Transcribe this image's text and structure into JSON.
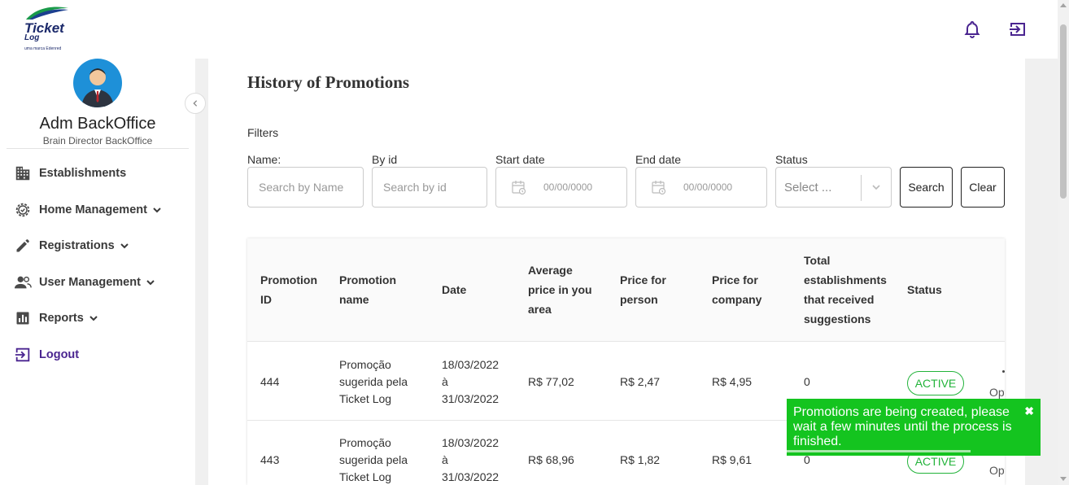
{
  "brand": {
    "name": "Ticket",
    "sub": "Log",
    "tagline": "uma marca Edenred"
  },
  "header": {
    "notification_icon": "bell-icon",
    "exit_icon": "exit-icon"
  },
  "user": {
    "name": "Adm BackOffice",
    "role": "Brain Director BackOffice"
  },
  "sidebar": {
    "items": [
      {
        "label": "Establishments",
        "icon": "building-icon"
      },
      {
        "label": "Home Management",
        "icon": "gear-check-icon"
      },
      {
        "label": "Registrations",
        "icon": "pencil-icon"
      },
      {
        "label": "User Management",
        "icon": "users-icon"
      },
      {
        "label": "Reports",
        "icon": "bar-chart-icon"
      },
      {
        "label": "Logout",
        "icon": "logout-icon"
      }
    ]
  },
  "page": {
    "title": "History of Promotions"
  },
  "filters": {
    "label": "Filters",
    "name": {
      "label": "Name:",
      "placeholder": "Search by Name"
    },
    "id": {
      "label": "By id",
      "placeholder": "Search by id"
    },
    "start": {
      "label": "Start date",
      "placeholder": "00/00/0000"
    },
    "end": {
      "label": "End date",
      "placeholder": "00/00/0000"
    },
    "status": {
      "label": "Status",
      "placeholder": "Select ..."
    },
    "search_button": "Search",
    "clear_button": "Clear"
  },
  "table": {
    "headers": {
      "id": [
        "Promotion",
        "ID"
      ],
      "name": [
        "Promotion",
        "name"
      ],
      "date": [
        "Date"
      ],
      "avg": [
        "Average",
        "price in you",
        "area"
      ],
      "person": [
        "Price for",
        "person"
      ],
      "company": [
        "Price for",
        "company"
      ],
      "total": [
        "Total",
        "establishments",
        "that received",
        "suggestions"
      ],
      "status": [
        "Status"
      ]
    },
    "rows": [
      {
        "id": "444",
        "name": [
          "Promoção",
          "sugerida pela",
          "Ticket Log"
        ],
        "date": [
          "18/03/2022",
          "à",
          "31/03/2022"
        ],
        "avg": "R$ 77,02",
        "person": "R$ 2,47",
        "company": "R$ 4,95",
        "total": "0",
        "status": "ACTIVE",
        "opt": "Opt"
      },
      {
        "id": "443",
        "name": [
          "Promoção",
          "sugerida pela",
          "Ticket Log"
        ],
        "date": [
          "18/03/2022",
          "à",
          "31/03/2022"
        ],
        "avg": "R$ 68,96",
        "person": "R$ 1,82",
        "company": "R$ 9,61",
        "total": "0",
        "status": "ACTIVE",
        "opt": "Opt"
      }
    ]
  },
  "toast": {
    "message": "Promotions are being created, please wait a few minutes until the process is finished.",
    "close": "✖",
    "color": "#14c41f"
  },
  "colors": {
    "accent": "#4a2590",
    "active": "#22b33a"
  }
}
